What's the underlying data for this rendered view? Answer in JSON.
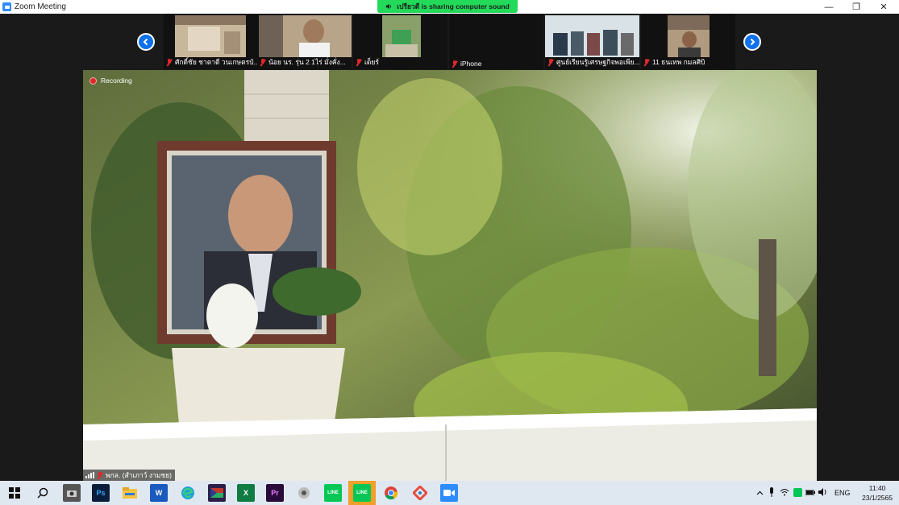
{
  "window": {
    "title": "Zoom Meeting",
    "sharing_notice": "เปรียวดี is sharing computer sound",
    "minimize_glyph": "—",
    "restore_glyph": "❐",
    "close_glyph": "✕"
  },
  "participants": [
    {
      "name": "ศักดิ์ชัย ชาตาดี วนเกษตรบ้...",
      "muted": true
    },
    {
      "name": "น้อย นร. รุ่น 2 1ไร่ มั่งคั่ง...",
      "muted": true
    },
    {
      "name": "เด็ยร์",
      "muted": true
    },
    {
      "name": "iPhone",
      "muted": true
    },
    {
      "name": "ศูนย์เรียนรู้เศรษฐกิจพอเพีย...",
      "muted": true
    },
    {
      "name": "11 ธนเทพ กมลศิบิ",
      "muted": true
    }
  ],
  "nav": {
    "prev_icon": "chevron-left-icon",
    "next_icon": "chevron-right-icon"
  },
  "main": {
    "recording_label": "Recording",
    "speaker_name": "พกล. (สำเภาว์ งามชย)"
  },
  "taskbar": {
    "apps": [
      "start-icon",
      "search-icon",
      "camera-app-icon",
      "photoshop-icon",
      "file-explorer-icon",
      "word-icon",
      "edge-icon",
      "gallery-icon",
      "excel-icon",
      "premiere-icon",
      "media-icon",
      "line-icon",
      "line-icon-2",
      "chrome-icon",
      "photos-icon",
      "zoom-icon"
    ],
    "ps_label": "Ps",
    "word_label": "W",
    "excel_label": "X",
    "pr_label": "Pr",
    "line_label": "LINE",
    "language": "ENG",
    "time": "11:40",
    "date": "23/1/2565"
  },
  "colors": {
    "zoom_blue": "#0e71eb",
    "share_green": "#23d959",
    "mute_red": "#e02828"
  }
}
